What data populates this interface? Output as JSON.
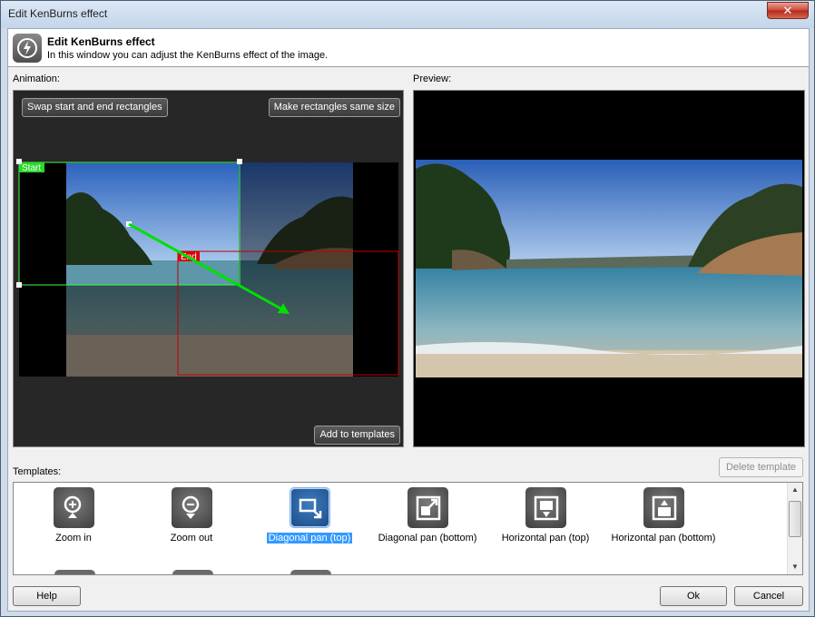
{
  "window": {
    "title": "Edit KenBurns effect",
    "close_label": "✕"
  },
  "header": {
    "title": "Edit KenBurns effect",
    "description": "In this window you can adjust the KenBurns effect of the image."
  },
  "animation": {
    "label": "Animation:",
    "swap_button": "Swap start and end rectangles",
    "same_size_button": "Make rectangles same size",
    "add_templates_button": "Add to templates",
    "start_label": "Start",
    "end_label": "End",
    "colors": {
      "start": "#00ff00",
      "end": "#cc0000",
      "arrow": "#00e000"
    }
  },
  "preview": {
    "label": "Preview:"
  },
  "templates": {
    "label": "Templates:",
    "delete_button": "Delete template",
    "items": [
      {
        "name": "Zoom in",
        "icon": "zoom-in-icon"
      },
      {
        "name": "Zoom out",
        "icon": "zoom-out-icon"
      },
      {
        "name": "Diagonal pan (top)",
        "icon": "diagonal-pan-top-icon",
        "selected": true
      },
      {
        "name": "Diagonal pan (bottom)",
        "icon": "diagonal-pan-bottom-icon"
      },
      {
        "name": "Horizontal pan (top)",
        "icon": "horizontal-pan-top-icon"
      },
      {
        "name": "Horizontal pan (bottom)",
        "icon": "horizontal-pan-bottom-icon"
      }
    ],
    "scroll_up": "▲",
    "scroll_down": "▼"
  },
  "footer": {
    "help_button": "Help",
    "ok_button": "Ok",
    "cancel_button": "Cancel"
  }
}
